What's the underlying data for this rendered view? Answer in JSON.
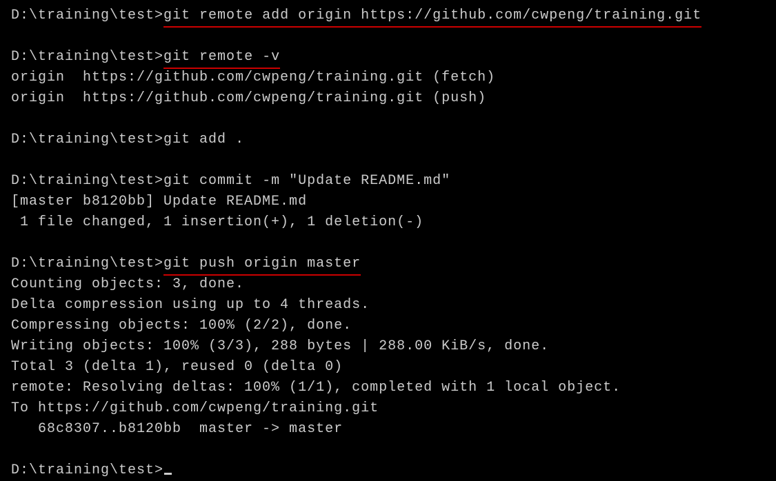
{
  "prompt": "D:\\training\\test>",
  "cmd1": "git remote add origin https://github.com/cwpeng/training.git",
  "cmd2": "git remote -v",
  "out2a": "origin  https://github.com/cwpeng/training.git (fetch)",
  "out2b": "origin  https://github.com/cwpeng/training.git (push)",
  "cmd3": "git add .",
  "cmd4": "git commit -m \"Update README.md\"",
  "out4a": "[master b8120bb] Update README.md",
  "out4b": " 1 file changed, 1 insertion(+), 1 deletion(-)",
  "cmd5": "git push origin master",
  "out5a": "Counting objects: 3, done.",
  "out5b": "Delta compression using up to 4 threads.",
  "out5c": "Compressing objects: 100% (2/2), done.",
  "out5d": "Writing objects: 100% (3/3), 288 bytes | 288.00 KiB/s, done.",
  "out5e": "Total 3 (delta 1), reused 0 (delta 0)",
  "out5f": "remote: Resolving deltas: 100% (1/1), completed with 1 local object.",
  "out5g": "To https://github.com/cwpeng/training.git",
  "out5h": "   68c8307..b8120bb  master -> master"
}
